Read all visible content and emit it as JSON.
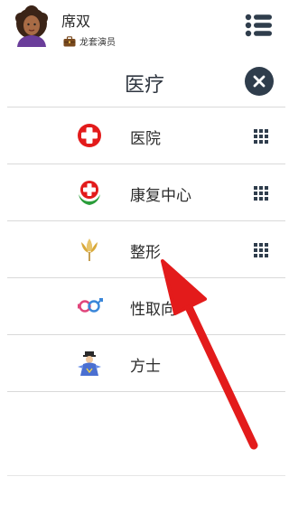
{
  "user": {
    "name": "席双",
    "job": "龙套演员"
  },
  "page": {
    "title": "医疗"
  },
  "items": [
    {
      "label": "医院",
      "icon": "hospital-cross-icon",
      "has_grid": true
    },
    {
      "label": "康复中心",
      "icon": "rehab-center-icon",
      "has_grid": true
    },
    {
      "label": "整形",
      "icon": "tulip-icon",
      "has_grid": true
    },
    {
      "label": "性取向",
      "icon": "gender-symbol-icon",
      "has_grid": false
    },
    {
      "label": "方士",
      "icon": "taoist-priest-icon",
      "has_grid": false
    }
  ],
  "colors": {
    "accent_red": "#e31b1b",
    "close_bg": "#2f3d4c",
    "divider": "#d9d9d9"
  }
}
